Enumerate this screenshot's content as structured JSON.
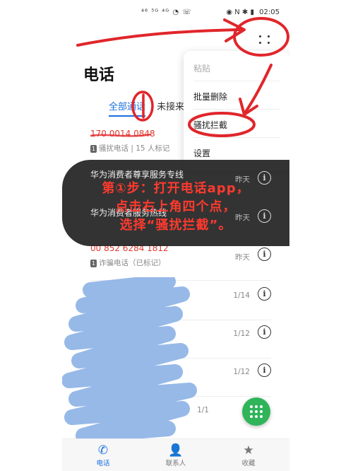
{
  "status_bar": {
    "left": "⁴⁶ ⁵ᴳ ⁴ᴳ ◔ ☏",
    "right": "◉ N ✱ ▮",
    "time": "02:05"
  },
  "page_title": "电话",
  "tabs": [
    {
      "label": "全部通话"
    },
    {
      "label": "未接来"
    }
  ],
  "menu": {
    "items": [
      {
        "label": "粘贴",
        "enabled": false
      },
      {
        "label": "批量删除",
        "enabled": true
      },
      {
        "label": "骚扰拦截",
        "enabled": true
      },
      {
        "label": "设置",
        "enabled": true
      }
    ]
  },
  "calls": [
    {
      "name": "170 0014 0848",
      "sim": "1",
      "detail": "骚扰电话 | 15 人标记",
      "time": "",
      "red": true
    },
    {
      "name": "华为消费者尊享服务专线",
      "sim": "1",
      "detail": "",
      "time": "昨天",
      "red": false
    },
    {
      "name": "华为消费者服务热线",
      "sim": "1",
      "detail": "",
      "time": "昨天",
      "red": false
    },
    {
      "name": "00 852 6284 1812",
      "sim": "1",
      "detail": "诈骗电话（已标记）",
      "time": "昨天",
      "red": true
    },
    {
      "name": "",
      "sim": "",
      "detail": "",
      "time": "1/14",
      "red": false
    },
    {
      "name": "",
      "sim": "",
      "detail": "",
      "time": "1/12",
      "red": false
    },
    {
      "name": "",
      "sim": "",
      "detail": "",
      "time": "1/12",
      "red": false
    },
    {
      "name": "",
      "sim": "",
      "detail": "",
      "time": "1/1",
      "red": false
    }
  ],
  "banner": {
    "lines": [
      "第①步：打开电话app，",
      "点击右上角四个点，",
      "选择“骚扰拦截”。"
    ]
  },
  "bottom_nav": [
    {
      "label": "电话",
      "icon": "phone-icon",
      "active": true
    },
    {
      "label": "联系人",
      "icon": "contacts-icon",
      "active": false
    },
    {
      "label": "收藏",
      "icon": "star-icon",
      "active": false
    }
  ],
  "colors": {
    "accent": "#1a6fe0",
    "danger": "#e03a2f",
    "annotation": "#e0262b",
    "fab": "#2fb45a",
    "scribble": "#8eb3e6"
  },
  "annotation_mark": "①"
}
